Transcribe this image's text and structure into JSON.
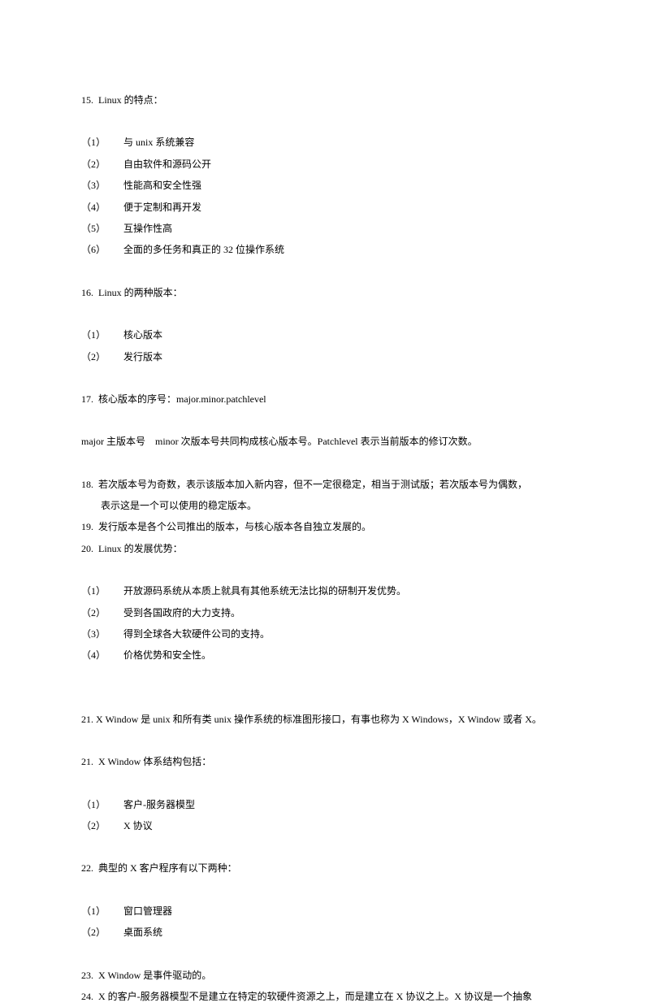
{
  "s15": {
    "title": "15.  Linux 的特点：",
    "items": [
      {
        "n": "（1）",
        "t": "与 unix 系统兼容"
      },
      {
        "n": "（2）",
        "t": "自由软件和源码公开"
      },
      {
        "n": "（3）",
        "t": "性能高和安全性强"
      },
      {
        "n": "（4）",
        "t": "便于定制和再开发"
      },
      {
        "n": "（5）",
        "t": "互操作性高"
      },
      {
        "n": "（6）",
        "t": "全面的多任务和真正的 32 位操作系统"
      }
    ]
  },
  "s16": {
    "title": "16.  Linux 的两种版本：",
    "items": [
      {
        "n": "（1）",
        "t": "核心版本"
      },
      {
        "n": "（2）",
        "t": "发行版本"
      }
    ]
  },
  "s17": {
    "title": "17.  核心版本的序号：major.minor.patchlevel",
    "desc": "major 主版本号    minor 次版本号共同构成核心版本号。Patchlevel 表示当前版本的修订次数。"
  },
  "s18": {
    "line1": "18.  若次版本号为奇数，表示该版本加入新内容，但不一定很稳定，相当于测试版；若次版本号为偶数，",
    "line2": "表示这是一个可以使用的稳定版本。"
  },
  "s19": "19.  发行版本是各个公司推出的版本，与核心版本各自独立发展的。",
  "s20": {
    "title": "20.  Linux 的发展优势：",
    "items": [
      {
        "n": "（1）",
        "t": "开放源码系统从本质上就具有其他系统无法比拟的研制开发优势。"
      },
      {
        "n": "（2）",
        "t": "受到各国政府的大力支持。"
      },
      {
        "n": "（3）",
        "t": "得到全球各大软硬件公司的支持。"
      },
      {
        "n": "（4）",
        "t": "价格优势和安全性。"
      }
    ]
  },
  "s21a": "21. X Window 是 unix 和所有类 unix 操作系统的标准图形接口，有事也称为 X Windows，X Window 或者 X。",
  "s21b": {
    "title": "21.  X Window 体系结构包括：",
    "items": [
      {
        "n": "（1）",
        "t": "客户-服务器模型"
      },
      {
        "n": "（2）",
        "t": "X 协议"
      }
    ]
  },
  "s22": {
    "title": "22.  典型的 X 客户程序有以下两种：",
    "items": [
      {
        "n": "（1）",
        "t": "窗口管理器"
      },
      {
        "n": "（2）",
        "t": "桌面系统"
      }
    ]
  },
  "s23": "23.  X Window 是事件驱动的。",
  "s24": "24.  X 的客户-服务器模型不是建立在特定的软硬件资源之上，而是建立在 X 协议之上。X 协议是一个抽象"
}
